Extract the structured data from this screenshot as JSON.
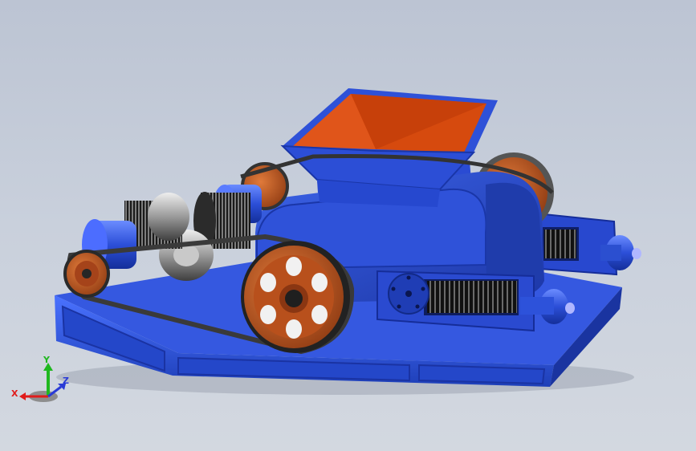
{
  "scene": {
    "background_top": "#bcc4d3",
    "background_bottom": "#d3d8e0",
    "frame_color": "#2f57d6",
    "hopper_inner_color": "#d64a0e",
    "pulley_color": "#c2561d",
    "motor_color": "#2b4fd0",
    "belt_color": "#3a3a3a",
    "spring_color": "#222222"
  },
  "triad": {
    "x_label": "X",
    "y_label": "Y",
    "z_label": "Z",
    "x_color": "#e01c1c",
    "y_color": "#1fb81f",
    "z_color": "#2a3bd6"
  }
}
